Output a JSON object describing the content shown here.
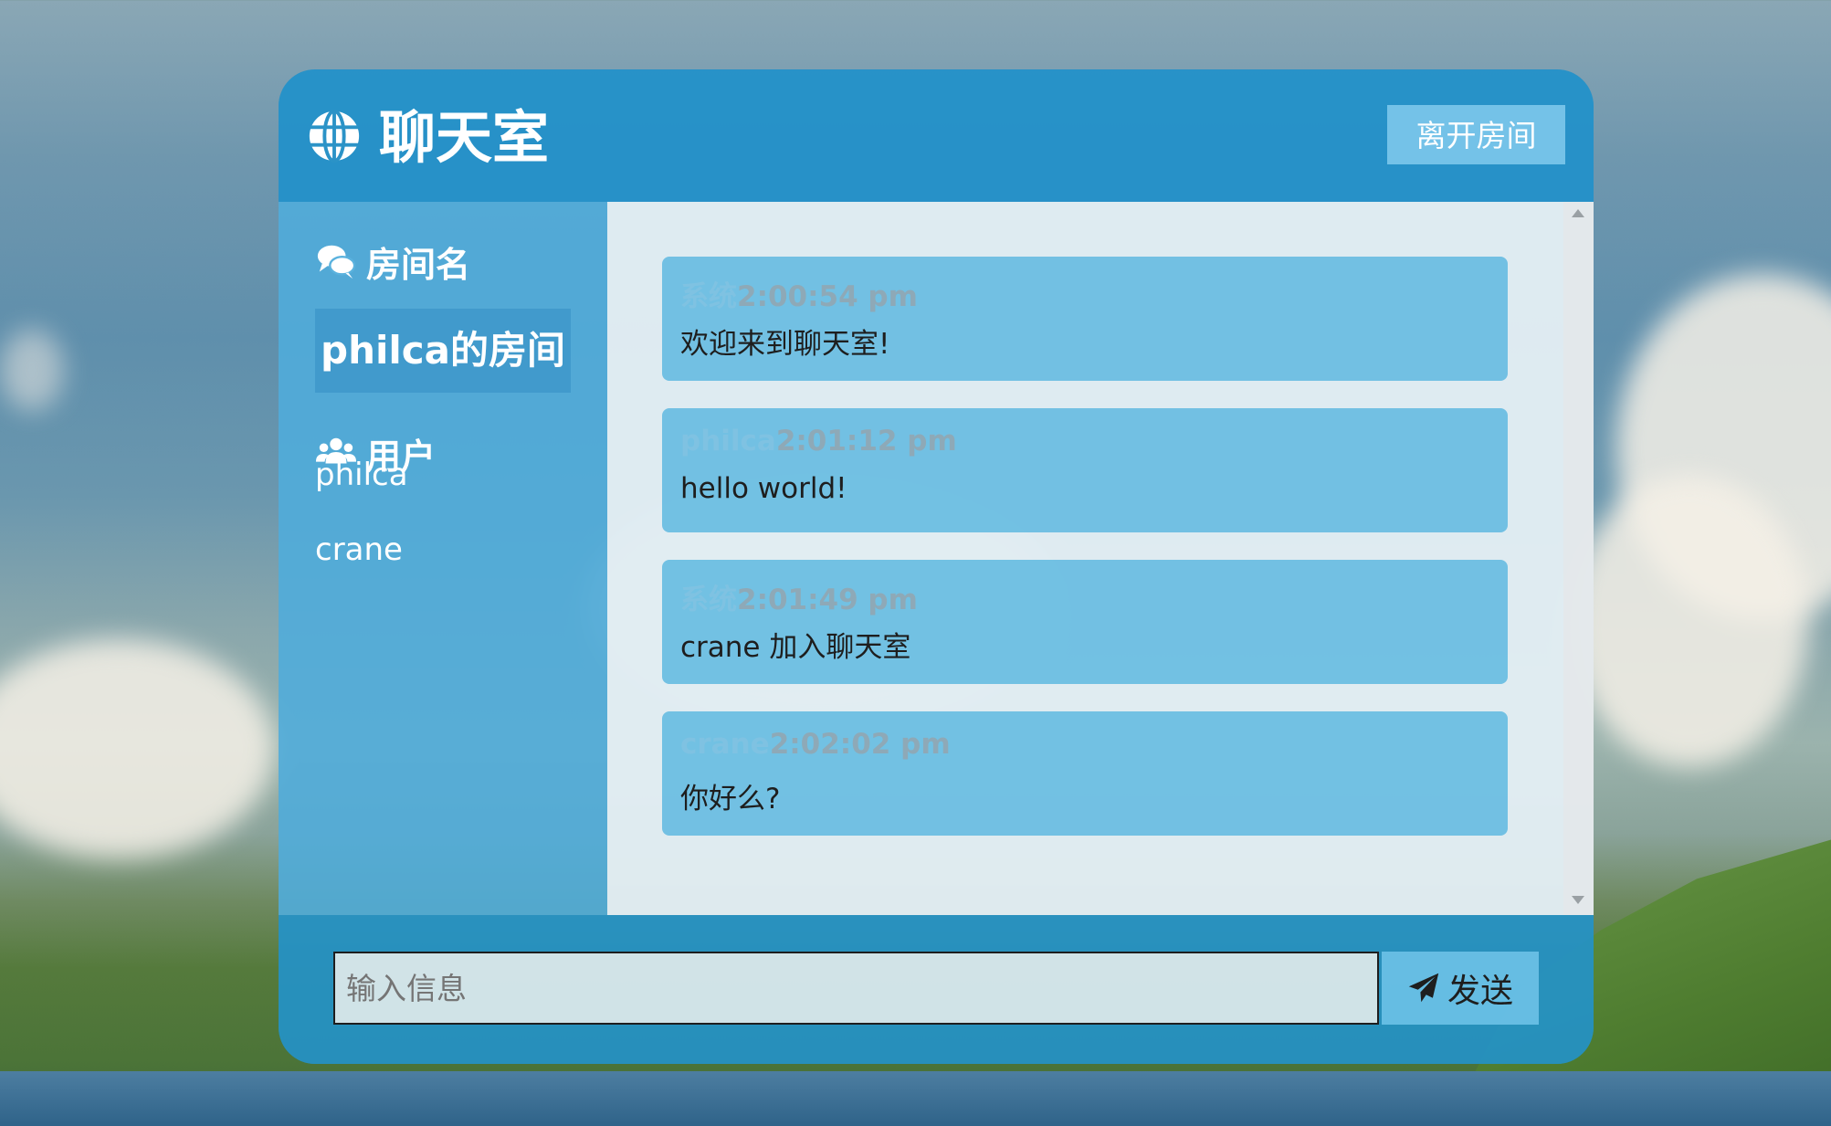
{
  "header": {
    "title": "聊天室",
    "leave_label": "离开房间"
  },
  "sidebar": {
    "room_heading": "房间名",
    "room_name": "philca的房间",
    "users_heading": "用户",
    "users": [
      "philca",
      "crane"
    ]
  },
  "messages": [
    {
      "sender": "系统",
      "time": "2:00:54 pm",
      "text": "欢迎来到聊天室!"
    },
    {
      "sender": "philca",
      "time": "2:01:12 pm",
      "text": "hello world!"
    },
    {
      "sender": "系统",
      "time": "2:01:49 pm",
      "text": "crane 加入聊天室"
    },
    {
      "sender": "crane",
      "time": "2:02:02 pm",
      "text": "你好么?"
    }
  ],
  "composer": {
    "placeholder": "输入信息",
    "send_label": "发送"
  },
  "colors": {
    "header_bg": "#2391c8",
    "sidebar_bg": "#5ab2de",
    "message_bubble": "#5fb9e1",
    "sender_name": "#7fc2e2",
    "timestamp": "#8ea9b7"
  },
  "icons": {
    "logo": "globe-icon",
    "room": "comments-icon",
    "users": "users-icon",
    "send": "paper-plane-icon"
  }
}
